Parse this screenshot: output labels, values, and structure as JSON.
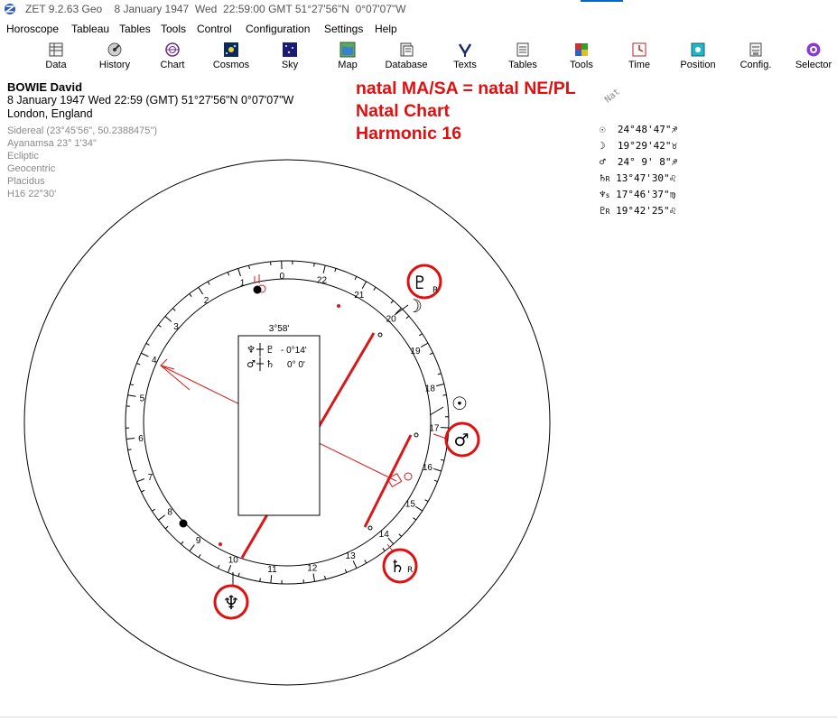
{
  "window": {
    "title": "ZET 9.2.63 Geo    8 January 1947  Wed  22:59:00 GMT 51°27'56\"N  0°07'07\"W"
  },
  "menu": [
    "Horoscope",
    "Tableau",
    "Tables",
    "Tools",
    "Control",
    "Configuration",
    "Settings",
    "Help"
  ],
  "toolbar": {
    "buttons": [
      {
        "label": "Data",
        "icon": "data-icon"
      },
      {
        "label": "History",
        "icon": "history-icon"
      },
      {
        "label": "Chart",
        "icon": "chart-icon"
      },
      {
        "label": "Cosmos",
        "icon": "cosmos-icon"
      },
      {
        "label": "Sky",
        "icon": "sky-icon"
      },
      {
        "label": "Map",
        "icon": "map-icon"
      },
      {
        "label": "Database",
        "icon": "database-icon"
      },
      {
        "label": "Texts",
        "icon": "texts-icon"
      },
      {
        "label": "Tables",
        "icon": "tables-icon"
      },
      {
        "label": "Tools",
        "icon": "tools-icon"
      },
      {
        "label": "Time",
        "icon": "time-icon"
      },
      {
        "label": "Position",
        "icon": "position-icon"
      },
      {
        "label": "Config.",
        "icon": "config-icon"
      },
      {
        "label": "Selector",
        "icon": "selector-icon"
      }
    ]
  },
  "info": {
    "name": "BOWIE David",
    "datetime": "8 January 1947  Wed  22:59 (GMT) 51°27'56\"N  0°07'07\"W",
    "place": "London, England",
    "settings": [
      "Sidereal (23°45'56\", 50.2388475\")",
      "Ayanamsa 23° 1'34\"",
      "Ecliptic",
      "Geocentric",
      "Placidus",
      "H16  22°30'"
    ]
  },
  "annotation": {
    "line1": "natal MA/SA = natal NE/PL",
    "line2": "Natal Chart",
    "line3": "Harmonic 16"
  },
  "positions": {
    "header": "Nat",
    "rows": [
      {
        "glyph": "☉",
        "retro": "",
        "value": "24°48'47\"",
        "sign": "♐",
        "label": "Sun"
      },
      {
        "glyph": "☽",
        "retro": "",
        "value": "19°29'42\"",
        "sign": "♉",
        "label": "Moon"
      },
      {
        "glyph": "♂",
        "retro": "",
        "value": "24° 9' 8\"",
        "sign": "♐",
        "label": "Mars"
      },
      {
        "glyph": "♄",
        "retro": "R",
        "value": "13°47'30\"",
        "sign": "♌",
        "label": "Saturn"
      },
      {
        "glyph": "♆",
        "retro": "s",
        "value": "17°46'37\"",
        "sign": "♍",
        "label": "Neptune"
      },
      {
        "glyph": "♇",
        "retro": "R",
        "value": "19°42'25\"",
        "sign": "♌",
        "label": "Pluto"
      }
    ]
  },
  "aspect_box": {
    "header": "3°58'",
    "row1": {
      "a": "♆",
      "b": "♇",
      "value": "- 0°14'"
    },
    "row2": {
      "a": "♂",
      "b": "♄",
      "value": "0° 0'"
    }
  },
  "chart": {
    "house_numbers": [
      "1",
      "2",
      "3",
      "4",
      "5",
      "6",
      "7",
      "8",
      "9",
      "10",
      "11",
      "12",
      "13",
      "14",
      "15",
      "16",
      "17",
      "18",
      "19",
      "20",
      "21",
      "22",
      "0"
    ],
    "planets": [
      {
        "glyph": "♇",
        "retro": "R",
        "label": "Pluto",
        "circled": true
      },
      {
        "glyph": "☽",
        "retro": "",
        "label": "Moon",
        "circled": false
      },
      {
        "glyph": "☉",
        "retro": "",
        "label": "Sun",
        "circled": false
      },
      {
        "glyph": "♂",
        "retro": "",
        "label": "Mars",
        "circled": true
      },
      {
        "glyph": "♄",
        "retro": "R",
        "label": "Saturn",
        "circled": true
      },
      {
        "glyph": "♆",
        "retro": "",
        "label": "Neptune",
        "circled": true
      }
    ],
    "colors": {
      "ring": "#000000",
      "aspect_line": "#d81818",
      "annotation": "#e01010"
    }
  }
}
